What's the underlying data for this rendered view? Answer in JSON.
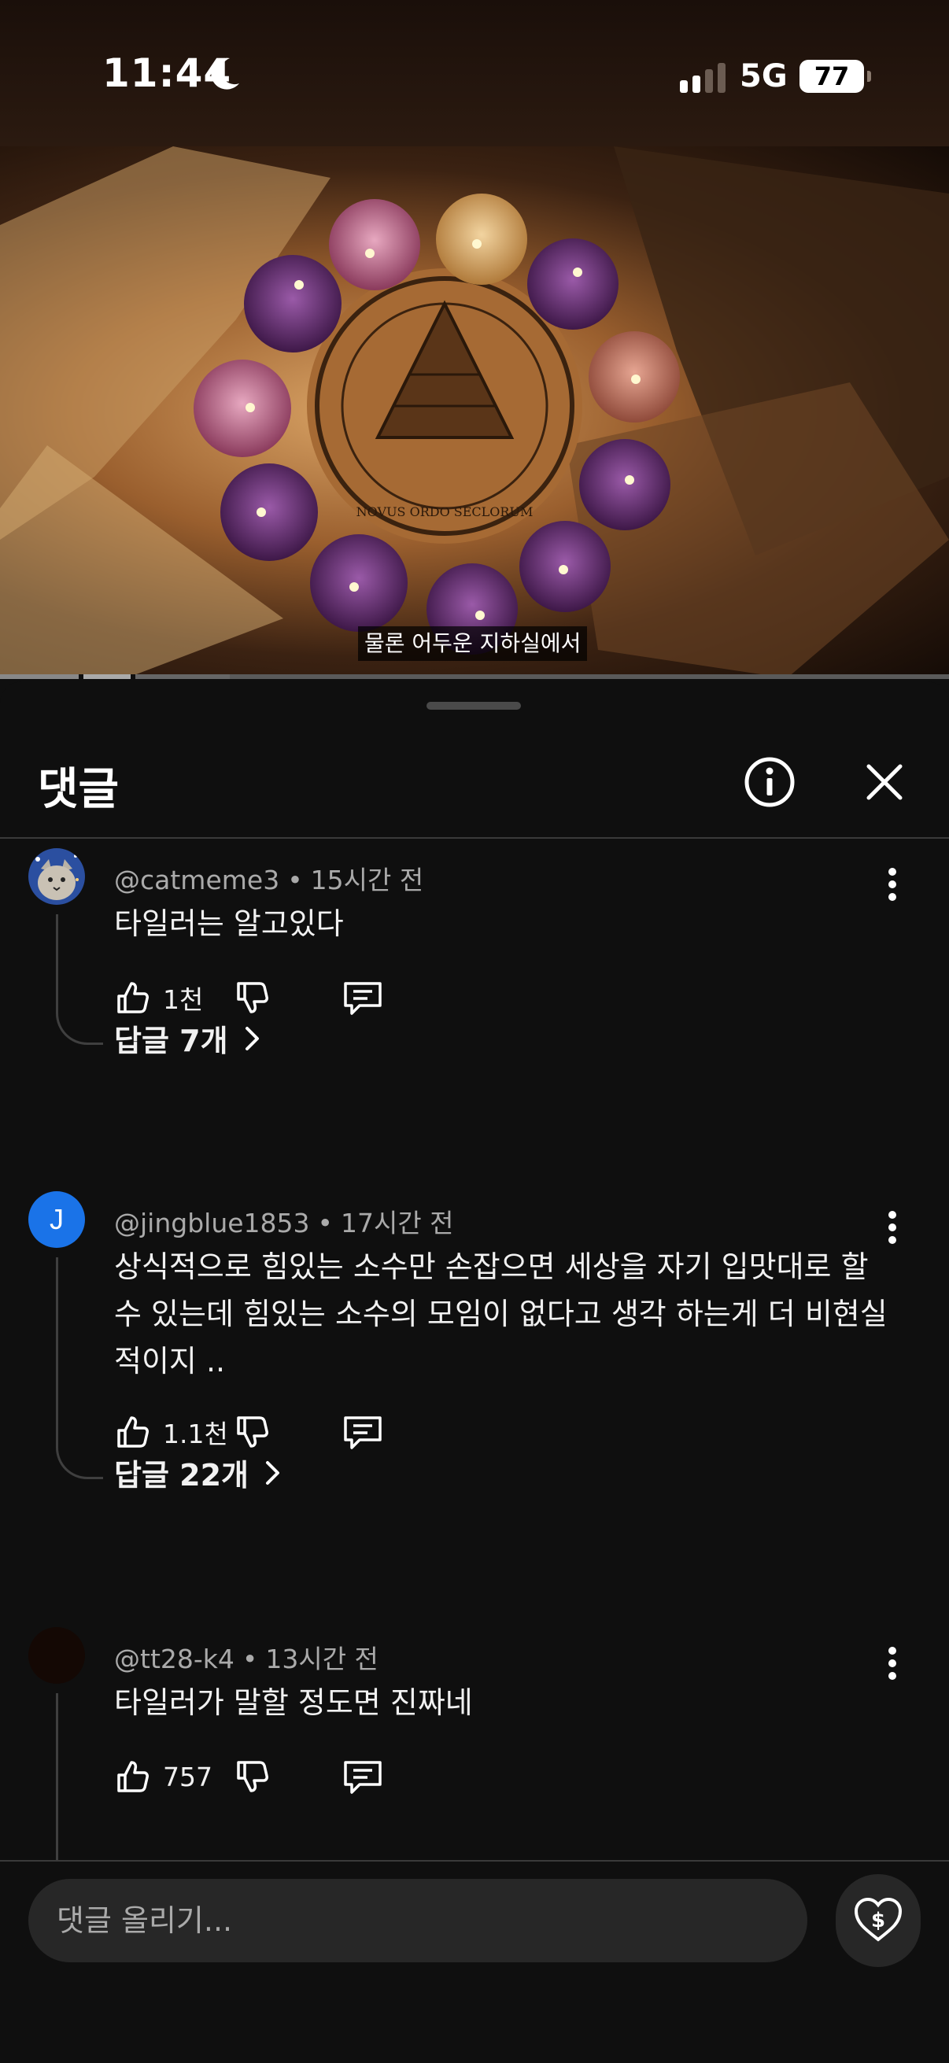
{
  "status_bar": {
    "time": "11:44",
    "network": "5G",
    "battery": "77"
  },
  "video": {
    "caption": "물론 어두운 지하실에서",
    "seal_text": "NOVUS ORDO SECLORUM"
  },
  "comments_sheet": {
    "title": "댓글",
    "composer_placeholder": "댓글 올리기...",
    "comments": [
      {
        "author": "@catmeme3",
        "time": "15시간 전",
        "text": "타일러는 알고있다",
        "likes": "1천",
        "replies": "답글 7개"
      },
      {
        "author": "@jingblue1853",
        "avatar_letter": "J",
        "time": "17시간 전",
        "text": "상식적으로 힘있는 소수만 손잡으면 세상을 자기 입맛대로 할수 있는데 힘있는 소수의 모임이 없다고 생각 하는게 더 비현실 적이지 ..",
        "likes": "1.1천",
        "replies": "답글 22개"
      },
      {
        "author": "@tt28-k4",
        "time": "13시간 전",
        "text": "타일러가 말할 정도면 진짜네",
        "likes": "757"
      }
    ]
  },
  "colors": {
    "background": "#0f0f0f",
    "avatar_blue": "#1a73e8",
    "muted_text": "#aaaaaa"
  },
  "icons": [
    "moon-icon",
    "signal-icon",
    "battery-icon",
    "info-icon",
    "close-icon",
    "kebab-icon",
    "like-icon",
    "dislike-icon",
    "reply-icon",
    "chevron-right-icon",
    "thanks-icon"
  ]
}
